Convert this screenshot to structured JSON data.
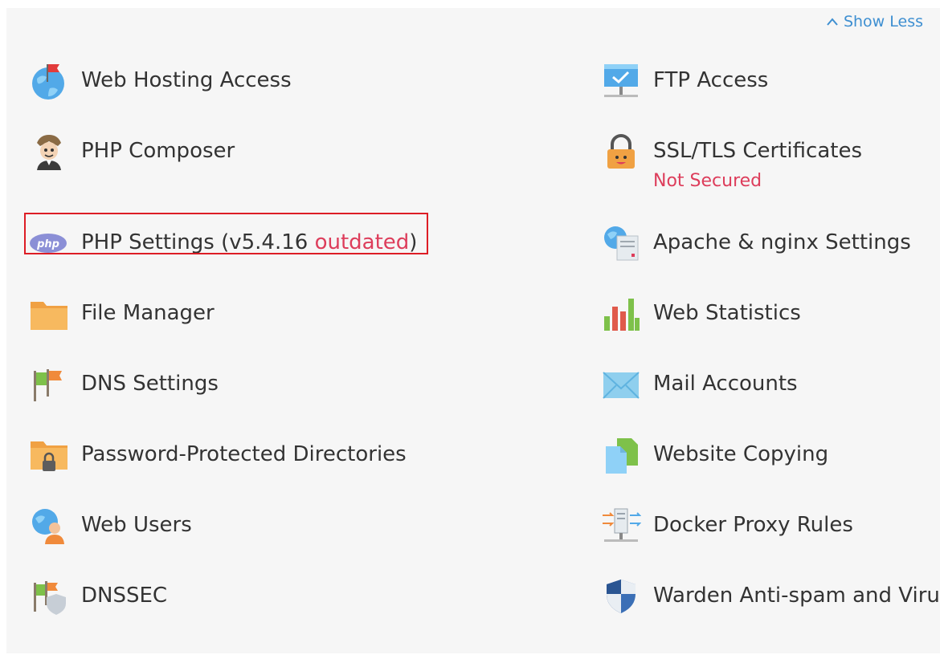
{
  "header": {
    "show_less": "Show Less"
  },
  "left_tools": [
    {
      "label": "Web Hosting Access",
      "icon": "globe-flag-icon"
    },
    {
      "label": "PHP Composer",
      "icon": "composer-conductor-icon"
    },
    {
      "label_prefix": "PHP Settings (v5.4.16 ",
      "label_warn": "outdated",
      "label_suffix": ")",
      "icon": "php-icon",
      "highlighted": true
    },
    {
      "label": "File Manager",
      "icon": "folder-icon"
    },
    {
      "label": "DNS Settings",
      "icon": "dns-flags-icon"
    },
    {
      "label": "Password-Protected Directories",
      "icon": "locked-folder-icon"
    },
    {
      "label": "Web Users",
      "icon": "globe-user-icon"
    },
    {
      "label": "DNSSEC",
      "icon": "flags-shield-icon"
    }
  ],
  "right_tools": [
    {
      "label": "FTP Access",
      "icon": "ftp-server-icon"
    },
    {
      "label": "SSL/TLS Certificates",
      "status": "Not Secured",
      "icon": "padlock-icon"
    },
    {
      "label": "Apache & nginx Settings",
      "icon": "web-server-settings-icon"
    },
    {
      "label": "Web Statistics",
      "icon": "bar-chart-icon"
    },
    {
      "label": "Mail Accounts",
      "icon": "envelope-icon"
    },
    {
      "label": "Website Copying",
      "icon": "copy-pages-icon"
    },
    {
      "label": "Docker Proxy Rules",
      "icon": "docker-proxy-icon"
    },
    {
      "label": "Warden Anti-spam and Viru",
      "icon": "shield-icon"
    }
  ],
  "colors": {
    "link": "#3e8fd1",
    "warning": "#dd3d5b",
    "highlight_border": "#dd1d25",
    "text": "#333333"
  }
}
